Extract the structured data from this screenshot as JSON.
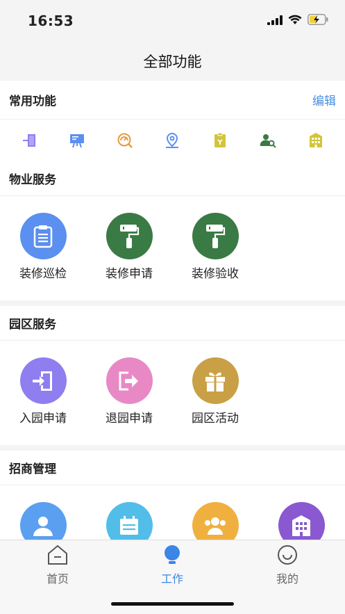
{
  "status": {
    "time": "16:53"
  },
  "nav": {
    "title": "全部功能"
  },
  "common": {
    "title": "常用功能",
    "edit_label": "编辑",
    "icons": [
      "enter-park-icon",
      "presentation-icon",
      "gauge-icon",
      "location-pin-icon",
      "clipboard-icon",
      "user-search-icon",
      "building-icon"
    ]
  },
  "property": {
    "title": "物业服务",
    "items": [
      {
        "label": "装修巡检",
        "icon": "clipboard-icon",
        "color": "#5b8ff0"
      },
      {
        "label": "装修申请",
        "icon": "paint-roller-icon",
        "color": "#3a7a44"
      },
      {
        "label": "装修验收",
        "icon": "paint-roller-icon",
        "color": "#3a7a44"
      }
    ]
  },
  "park": {
    "title": "园区服务",
    "items": [
      {
        "label": "入园申请",
        "icon": "enter-door-icon",
        "color": "#8f7ef0"
      },
      {
        "label": "退园申请",
        "icon": "exit-door-icon",
        "color": "#e889c6"
      },
      {
        "label": "园区活动",
        "icon": "gift-icon",
        "color": "#c9a046"
      }
    ]
  },
  "investment": {
    "title": "招商管理",
    "items": [
      {
        "label": "",
        "icon": "customer-icon",
        "color": "#5b9ff0"
      },
      {
        "label": "",
        "icon": "calendar-icon",
        "color": "#52bde8"
      },
      {
        "label": "",
        "icon": "group-icon",
        "color": "#f0b040"
      },
      {
        "label": "",
        "icon": "building-icon",
        "color": "#8a58d0"
      }
    ]
  },
  "tabs": [
    {
      "label": "首页",
      "active": false
    },
    {
      "label": "工作",
      "active": true
    },
    {
      "label": "我的",
      "active": false
    }
  ],
  "colors": {
    "accent": "#3b86e6",
    "inactive": "#666666"
  }
}
